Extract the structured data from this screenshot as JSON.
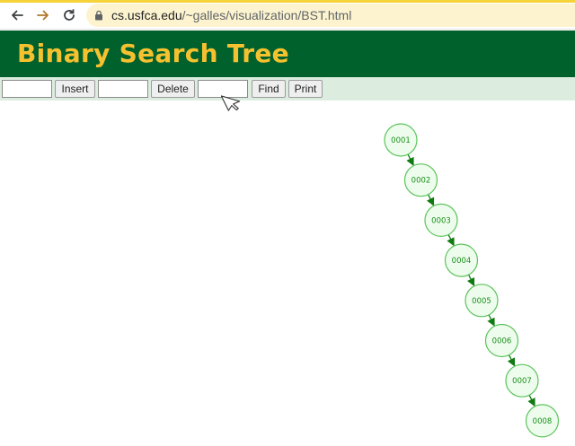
{
  "browser": {
    "url_host": "cs.usfca.edu",
    "url_path": "/~galles/visualization/BST.html",
    "accent_color": "#f7d33a"
  },
  "header": {
    "title": "Binary Search Tree",
    "background_color": "#00612d",
    "title_color": "#f6c12f"
  },
  "controls": {
    "insert_value": "",
    "insert_label": "Insert",
    "delete_value": "",
    "delete_label": "Delete",
    "find_value": "",
    "find_label": "Find",
    "print_label": "Print",
    "bar_color": "#dcede0"
  },
  "tree": {
    "nodes": [
      "0001",
      "0002",
      "0003",
      "0004",
      "0005",
      "0006",
      "0007",
      "0008"
    ],
    "edges": [
      [
        "0001",
        "0002"
      ],
      [
        "0002",
        "0003"
      ],
      [
        "0003",
        "0004"
      ],
      [
        "0004",
        "0005"
      ],
      [
        "0005",
        "0006"
      ],
      [
        "0006",
        "0007"
      ],
      [
        "0007",
        "0008"
      ]
    ],
    "node_fill": "#eefcee",
    "node_stroke": "#5cc45c",
    "edge_color": "#0f7a0f"
  },
  "icons": {
    "back": "arrow-left-icon",
    "forward": "arrow-right-icon",
    "reload": "reload-icon",
    "lock": "lock-icon",
    "cursor": "mouse-pointer-icon"
  }
}
